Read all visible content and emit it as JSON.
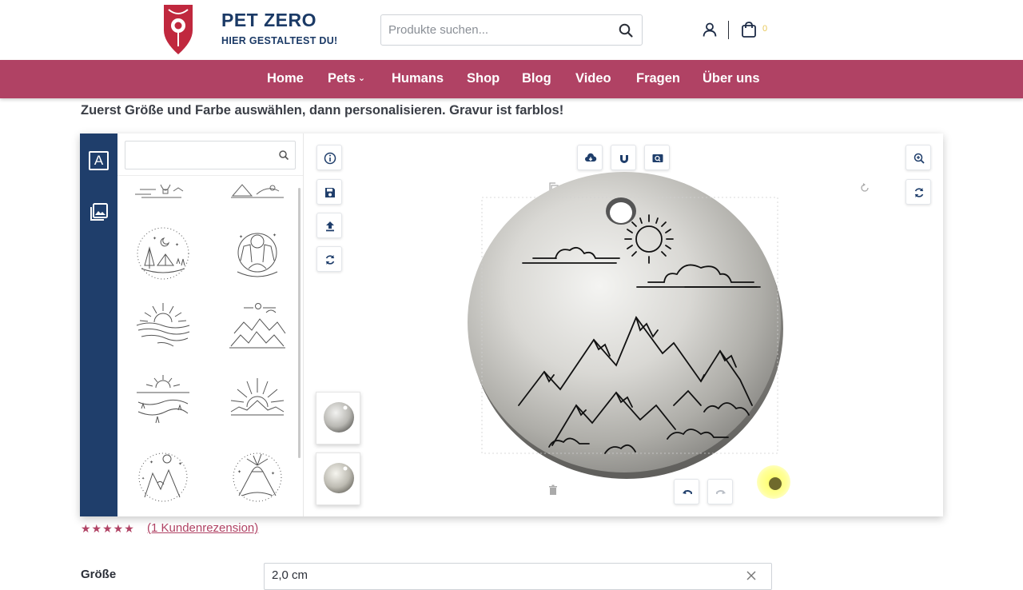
{
  "brand": {
    "title": "PET ZERO",
    "subtitle": "HIER GESTALTEST DU!",
    "logo_text": "PET"
  },
  "search": {
    "placeholder": "Produkte suchen..."
  },
  "cart": {
    "count": "0"
  },
  "nav": {
    "items": [
      {
        "label": "Home"
      },
      {
        "label": "Pets",
        "has_dropdown": true
      },
      {
        "label": "Humans"
      },
      {
        "label": "Shop"
      },
      {
        "label": "Blog"
      },
      {
        "label": "Video"
      },
      {
        "label": "Fragen"
      },
      {
        "label": "Über uns"
      }
    ]
  },
  "instruction": "Zuerst Größe und Farbe auswählen, dann personalisieren. Gravur ist farblos!",
  "designer": {
    "tabs": {
      "text_tab": "A"
    },
    "library": {
      "search_placeholder": ""
    },
    "tag_design": "sun, clouds and mountains engraving"
  },
  "product": {
    "stars": "★★★★★",
    "reviews_link": "(1 Kundenrezension)",
    "size_label": "Größe",
    "size_value": "2,0 cm"
  },
  "colors": {
    "nav": "#b04264",
    "brand": "#1b3a66",
    "sidebar": "#1f3e6b",
    "logo": "#c0283e"
  }
}
